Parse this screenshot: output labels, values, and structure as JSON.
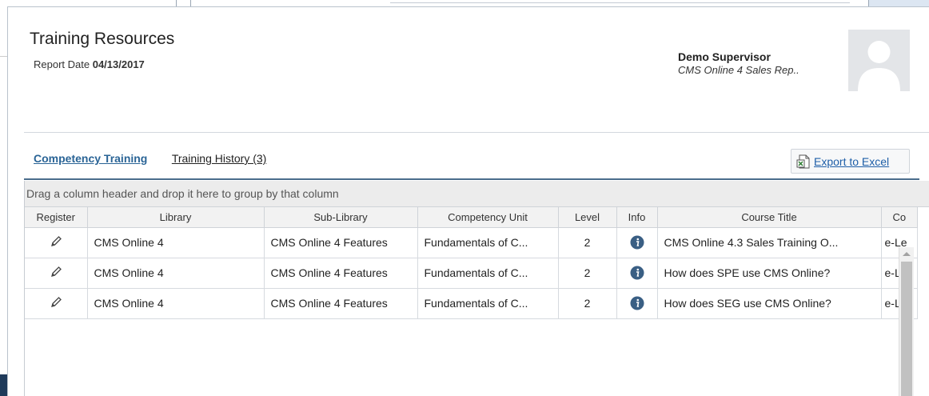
{
  "page": {
    "title": "Training Resources",
    "report_date_label": "Report Date",
    "report_date_value": "04/13/2017"
  },
  "user": {
    "name": "Demo Supervisor",
    "role": "CMS Online 4 Sales Rep..",
    "avatar_icon": "user-avatar-placeholder-icon"
  },
  "tabs": [
    {
      "label": "Competency Training",
      "active": true
    },
    {
      "label": "Training History (3)",
      "active": false
    }
  ],
  "export": {
    "label": "Export to Excel",
    "icon": "excel-export-icon"
  },
  "grid": {
    "group_hint": "Drag a column header and drop it here to group by that column",
    "columns": [
      "Register",
      "Library",
      "Sub-Library",
      "Competency Unit",
      "Level",
      "Info",
      "Course Title",
      "Co"
    ],
    "rows": [
      {
        "library": "CMS Online 4",
        "sub_library": "CMS Online 4 Features",
        "competency_unit": "Fundamentals of C...",
        "level": "2",
        "course_title": "CMS Online 4.3 Sales Training O...",
        "co": "e-Le"
      },
      {
        "library": "CMS Online 4",
        "sub_library": "CMS Online 4 Features",
        "competency_unit": "Fundamentals of C...",
        "level": "2",
        "course_title": "How does SPE use CMS Online?",
        "co": "e-Le"
      },
      {
        "library": "CMS Online 4",
        "sub_library": "CMS Online 4 Features",
        "competency_unit": "Fundamentals of C...",
        "level": "2",
        "course_title": "How does SEG use CMS Online?",
        "co": "e-Le"
      }
    ]
  },
  "colors": {
    "accent": "#2a6496",
    "link": "#1f5fa8",
    "info_icon": "#3a5f84"
  }
}
